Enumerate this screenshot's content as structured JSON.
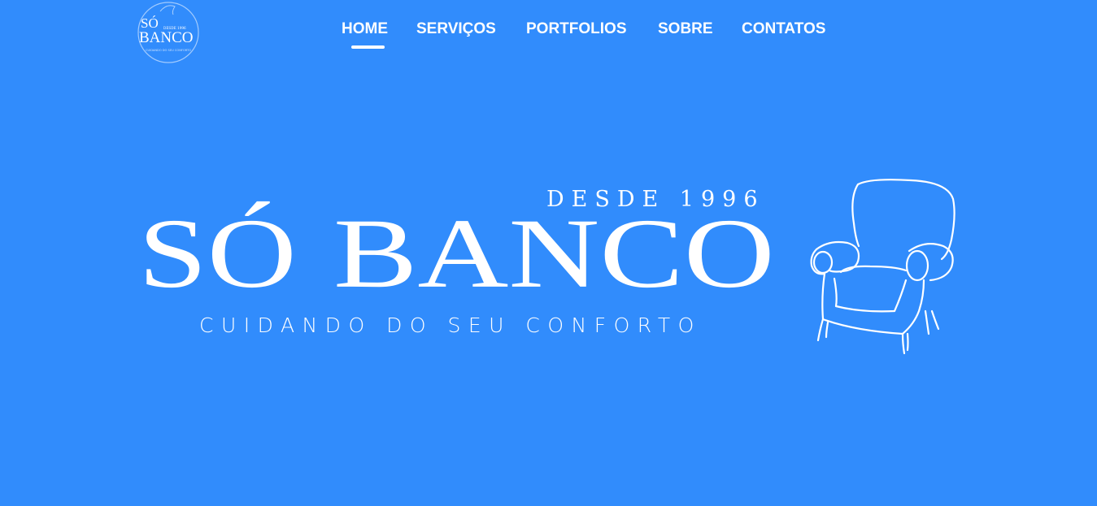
{
  "header": {
    "logo": {
      "name": "sobanco-logo",
      "line1": "SÓ",
      "line2": "BANCO",
      "small_text": "DESDE 1996",
      "ring_text": "CUIDANDO DO SEU CONFORTO"
    },
    "nav": [
      {
        "label": "HOME",
        "active": true
      },
      {
        "label": "SERVIÇOS",
        "active": false
      },
      {
        "label": "PORTFOLIOS",
        "active": false
      },
      {
        "label": "SOBRE",
        "active": false
      },
      {
        "label": "CONTATOS",
        "active": false
      }
    ]
  },
  "hero": {
    "since": "DESDE 1996",
    "brand_part1": "SÓ",
    "brand_part2": "BANCO",
    "tagline": "CUIDANDO DO SEU CONFORTO",
    "illustration": "armchair-icon"
  },
  "colors": {
    "background": "#318cfc",
    "foreground": "#ffffff"
  }
}
